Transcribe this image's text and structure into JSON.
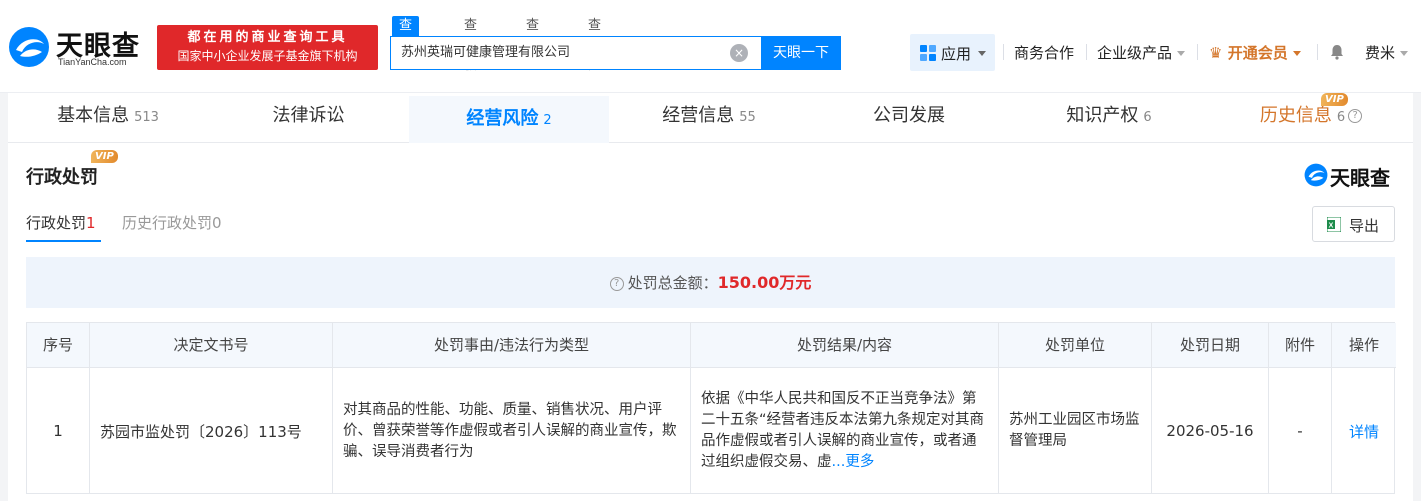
{
  "brand": {
    "name": "天眼查",
    "domain": "TianYanCha.com",
    "banner_line1": "都在用的商业查询工具",
    "banner_line2": "国家中小企业发展子基金旗下机构"
  },
  "search": {
    "tabs": [
      "查公司",
      "查老板",
      "查关系",
      "查风险"
    ],
    "value": "苏州英瑞可健康管理有限公司",
    "button": "天眼一下",
    "clear_icon": "close-circle-icon"
  },
  "nav": {
    "app": "应用",
    "business": "商务合作",
    "enterprise": "企业级产品",
    "vip": "开通会员",
    "user": "费米"
  },
  "tabs": [
    {
      "label": "基本信息",
      "count": "513"
    },
    {
      "label": "法律诉讼",
      "count": ""
    },
    {
      "label": "经营风险",
      "count": "2"
    },
    {
      "label": "经营信息",
      "count": "55"
    },
    {
      "label": "公司发展",
      "count": ""
    },
    {
      "label": "知识产权",
      "count": "6"
    },
    {
      "label": "历史信息",
      "count": "6"
    }
  ],
  "vip_label": "VIP",
  "section": {
    "title": "行政处罚",
    "brand": "天眼查",
    "subtabs": [
      {
        "label": "行政处罚",
        "count": "1"
      },
      {
        "label": "历史行政处罚",
        "count": "0"
      }
    ],
    "export": "导出",
    "summary_label": "处罚总金额：",
    "summary_amount": "150.00万元"
  },
  "table": {
    "headers": [
      "序号",
      "决定文书号",
      "处罚事由/违法行为类型",
      "处罚结果/内容",
      "处罚单位",
      "处罚日期",
      "附件",
      "操作"
    ],
    "rows": [
      {
        "index": "1",
        "doc_no": "苏园市监处罚〔2026〕113号",
        "reason": "对其商品的性能、功能、质量、销售状况、用户评价、曾获荣誉等作虚假或者引人误解的商业宣传，欺骗、误导消费者行为",
        "result": "依据《中华人民共和国反不正当竞争法》第二十五条“经营者违反本法第九条规定对其商品作虚假或者引人误解的商业宣传，或者通过组织虚假交易、虚",
        "more": "...更多",
        "unit": "苏州工业园区市场监督管理局",
        "date": "2026-05-16",
        "attachment": "-",
        "action": "详情"
      }
    ]
  }
}
